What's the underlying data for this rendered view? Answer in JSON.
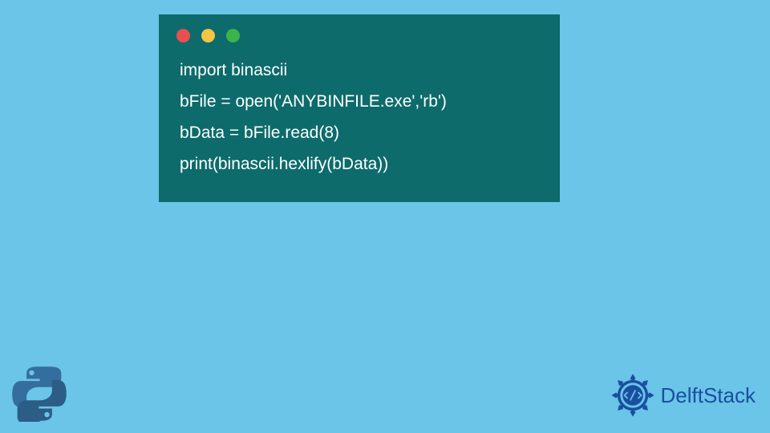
{
  "code": {
    "lines": [
      "import binascii",
      "bFile = open('ANYBINFILE.exe','rb')",
      "bData = bFile.read(8)",
      "print(binascii.hexlify(bData))"
    ]
  },
  "brand": {
    "name": "DelftStack"
  },
  "icons": {
    "window_red": "red",
    "window_yellow": "yellow",
    "window_green": "green"
  }
}
